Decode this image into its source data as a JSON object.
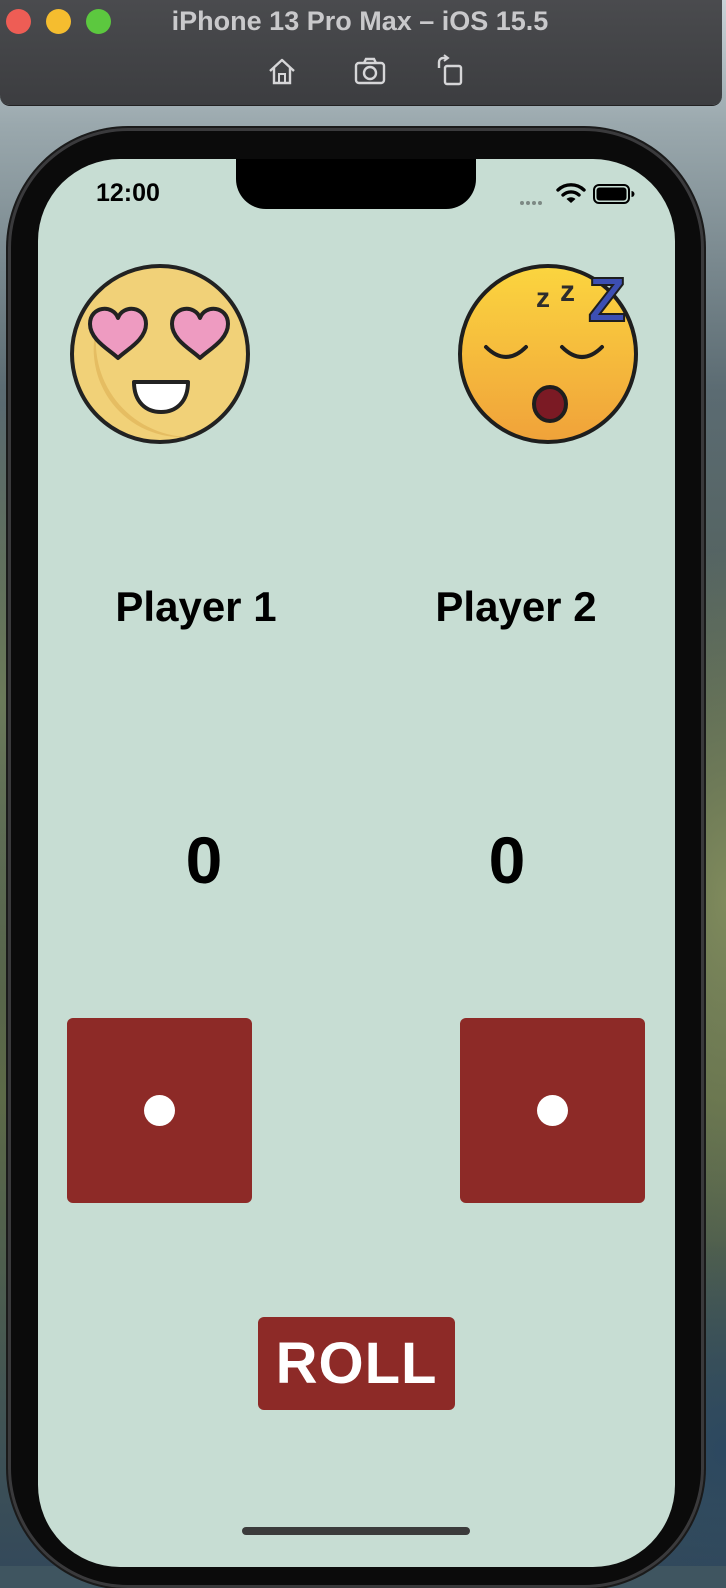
{
  "simulator": {
    "title": "iPhone 13 Pro Max – iOS 15.5",
    "tools": [
      "home-icon",
      "screenshot-icon",
      "rotate-icon"
    ]
  },
  "status_bar": {
    "time": "12:00"
  },
  "players": [
    {
      "name": "Player 1",
      "score": "0",
      "emoji": "heart-eyes-emoji",
      "die_value": 1
    },
    {
      "name": "Player 2",
      "score": "0",
      "emoji": "sleeping-emoji",
      "die_value": 1
    }
  ],
  "roll_button": {
    "label": "ROLL"
  },
  "colors": {
    "screen_background": "#c7ddd3",
    "die": "#8d2a27",
    "button": "#8d2a27"
  }
}
